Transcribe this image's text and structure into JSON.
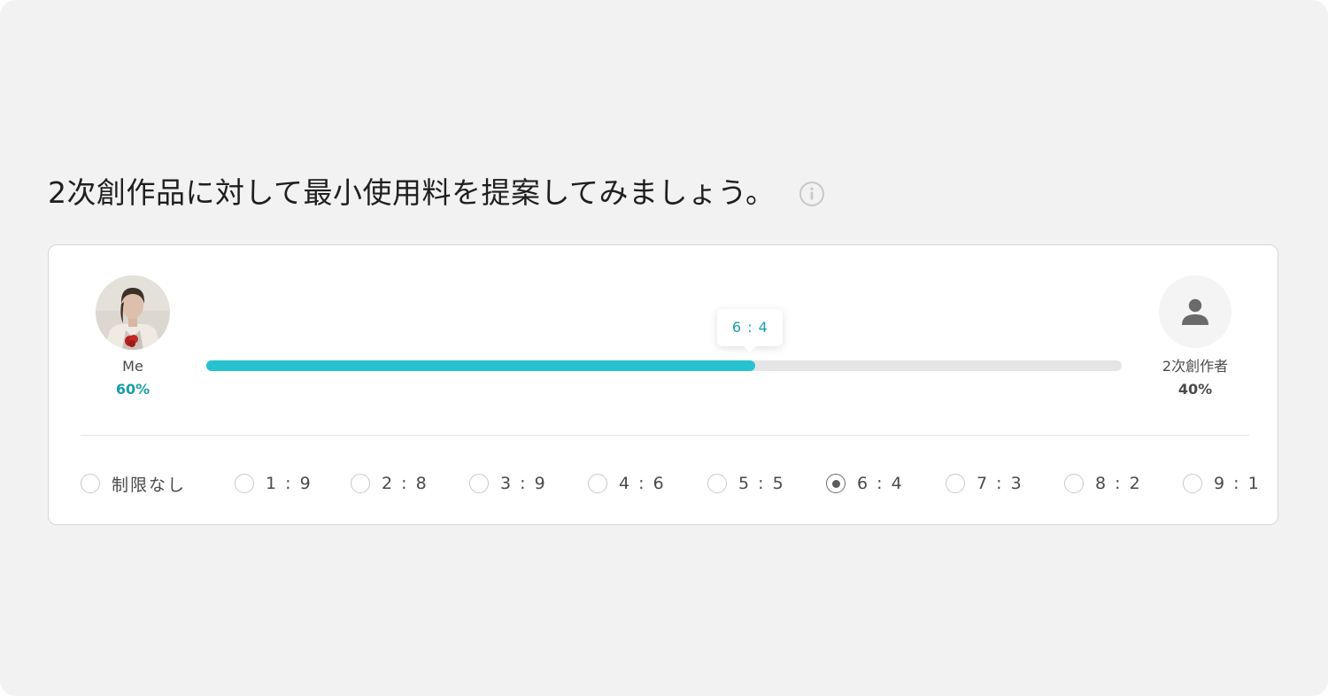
{
  "heading": {
    "title": "2次創作品に対して最小使用料を提案してみましょう。",
    "info_icon": "info-circle-icon"
  },
  "left_party": {
    "name": "Me",
    "percent": "60%",
    "avatar": "user-photo-avatar"
  },
  "right_party": {
    "name": "2次創作者",
    "percent": "40%",
    "avatar_icon": "person-icon"
  },
  "slider": {
    "ratio_label": "6 : 4",
    "fill_fraction": 0.6,
    "fill_color": "#26c2d0",
    "track_color": "#e5e5e5"
  },
  "options": [
    {
      "label": "制限なし",
      "checked": false
    },
    {
      "label": "1 : 9",
      "checked": false
    },
    {
      "label": "2 : 8",
      "checked": false
    },
    {
      "label": "3 : 9",
      "checked": false
    },
    {
      "label": "4 : 6",
      "checked": false
    },
    {
      "label": "5 : 5",
      "checked": false
    },
    {
      "label": "6 : 4",
      "checked": true
    },
    {
      "label": "7 : 3",
      "checked": false
    },
    {
      "label": "8 : 2",
      "checked": false
    },
    {
      "label": "9 : 1",
      "checked": false
    }
  ],
  "colors": {
    "accent": "#1a9eaa",
    "background": "#f2f2f2",
    "text": "#1f1f1f"
  }
}
